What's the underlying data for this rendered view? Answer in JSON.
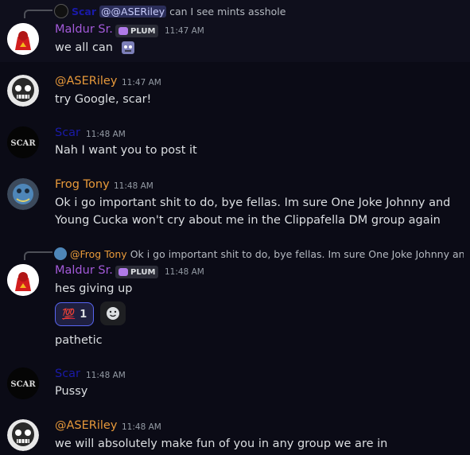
{
  "colors": {
    "background": "#0b0b16",
    "maldur": "#a35ad9",
    "riley": "#e6983a",
    "scar": "#1a1aa8",
    "tony": "#e89a3a",
    "mention_bg": "#2b2e5a",
    "reaction_border": "#5865f2"
  },
  "messages": [
    {
      "reply": {
        "author": "Scar",
        "mention": "@@ASERiley",
        "text": "can I see mints asshole"
      },
      "author": "Maldur Sr.",
      "badge": "PLUM",
      "time": "11:47 AM",
      "lines": [
        "we all can"
      ]
    },
    {
      "author": "@ASERiley",
      "time": "11:47 AM",
      "lines": [
        "try Google, scar!"
      ]
    },
    {
      "author": "Scar",
      "time": "11:48 AM",
      "lines": [
        "Nah I want you to post it"
      ]
    },
    {
      "author": "Frog Tony",
      "time": "11:48 AM",
      "lines": [
        "Ok i go important shit to do, bye fellas. Im sure One Joke Johnny and",
        "Young Cucka won't cry about me in the Clippafella DM group again"
      ]
    },
    {
      "reply": {
        "author": "@Frog Tony",
        "text": "Ok i go important shit to do, bye fellas. Im sure One Joke Johnny and..."
      },
      "author": "Maldur Sr.",
      "badge": "PLUM",
      "time": "11:48 AM",
      "lines": [
        "hes giving up",
        "pathetic"
      ],
      "reaction": {
        "emoji": "100",
        "count": "1"
      }
    },
    {
      "author": "Scar",
      "time": "11:48 AM",
      "lines": [
        "Pussy"
      ]
    },
    {
      "author": "@ASERiley",
      "time": "11:48 AM",
      "lines": [
        "we will absolutely make fun of you in any group we are in"
      ]
    }
  ]
}
